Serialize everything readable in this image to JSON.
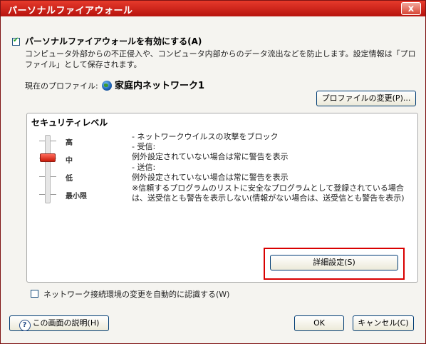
{
  "window": {
    "title": "パーソナルファイアウォール",
    "close_glyph": "x"
  },
  "enable_firewall": {
    "label": "パーソナルファイアウォールを有効にする(A)",
    "checked": true,
    "description_line1": "コンピュータ外部からの不正侵入や、コンピュータ内部からのデータ流出などを防止します。設定情報は「プロ",
    "description_line2": "ファイル」として保存されます。"
  },
  "profile": {
    "label": "現在のプロファイル:",
    "name": "家庭内ネットワーク1",
    "icon": "globe-icon",
    "change_button": "プロファイルの変更(P)..."
  },
  "security": {
    "group_title": "セキュリティレベル",
    "levels": [
      "高",
      "中",
      "低",
      "最小限"
    ],
    "selected_level": "中",
    "description": [
      "- ネットワークウイルスの攻撃をブロック",
      "- 受信:",
      "  例外設定されていない場合は常に警告を表示",
      "- 送信:",
      "  例外設定されていない場合は常に警告を表示",
      "※信頼するプログラムのリストに安全なプログラムとして登録されている場合",
      "は、送受信とも警告を表示しない(情報がない場合は、送受信とも警告を表示)"
    ],
    "detail_button": "詳細設定(S)"
  },
  "auto_detect": {
    "label": "ネットワーク接続環境の変更を自動的に認識する(W)",
    "checked": false
  },
  "footer": {
    "help_icon_glyph": "?",
    "help_button": "この画面の説明(H)",
    "ok_button": "OK",
    "cancel_button": "キャンセル(C)"
  },
  "colors": {
    "title_bar": "#c8201a",
    "highlight_box": "#d90000",
    "slider_thumb": "#e03a2a"
  }
}
